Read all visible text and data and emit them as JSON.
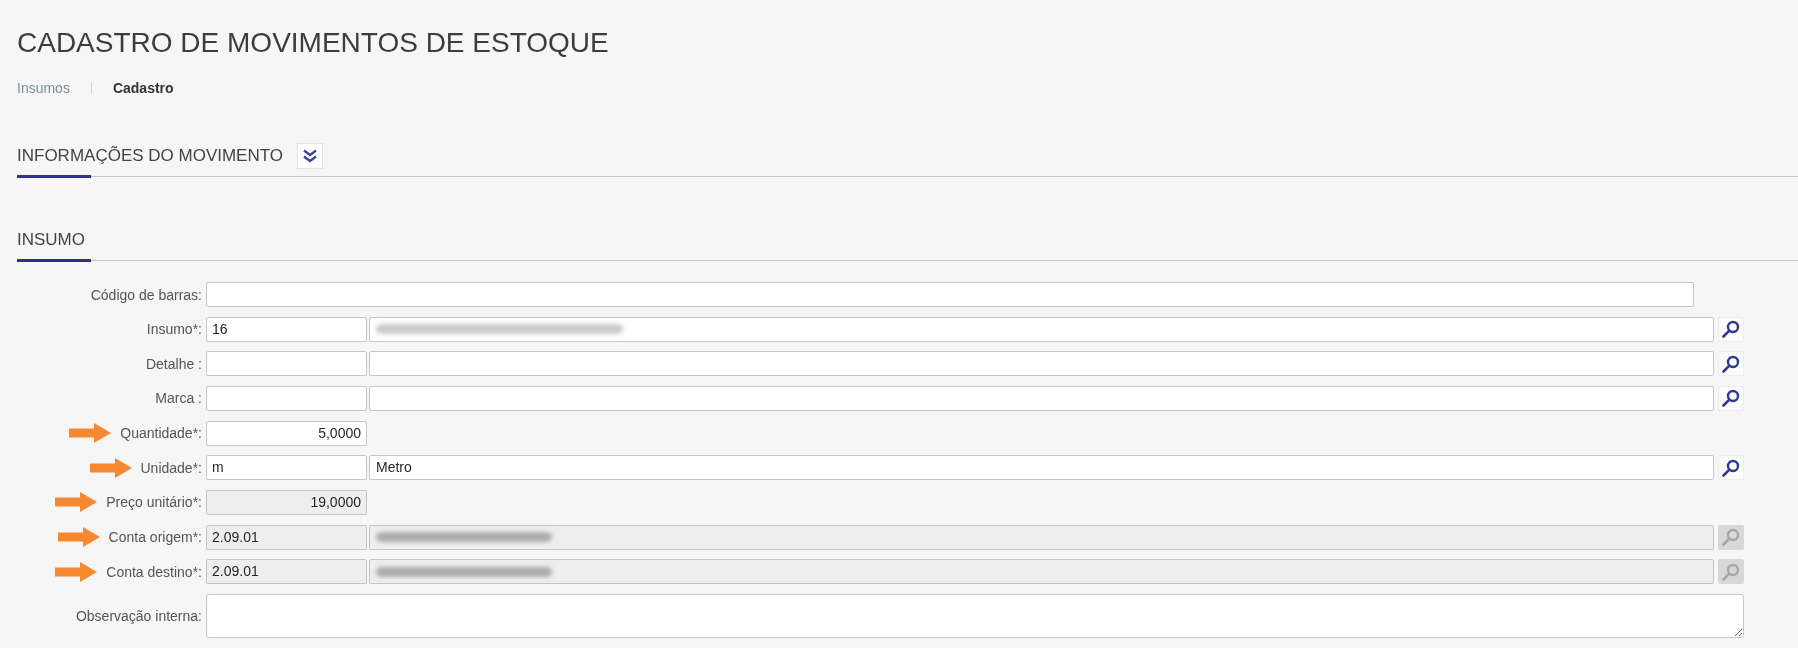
{
  "page": {
    "title": "CADASTRO DE MOVIMENTOS DE ESTOQUE"
  },
  "breadcrumb": [
    {
      "label": "Insumos",
      "current": false
    },
    {
      "label": "Cadastro",
      "current": true
    }
  ],
  "sections": [
    {
      "title": "INFORMAÇÕES DO MOVIMENTO",
      "toggle": {
        "expanded": false
      }
    },
    {
      "title": "INSUMO",
      "fields": [
        {
          "kind": "text",
          "label": "Código de barras:",
          "annotated": false,
          "disabled": false
        },
        {
          "kind": "lookup",
          "label": "Insumo*:",
          "code": "16",
          "description_blurred": true,
          "annotated": false,
          "disabled": false
        },
        {
          "kind": "lookup",
          "label": "Detalhe :",
          "description_blurred": false,
          "annotated": false,
          "disabled": false
        },
        {
          "kind": "lookup",
          "label": "Marca :",
          "description_blurred": false,
          "annotated": false,
          "disabled": false
        },
        {
          "kind": "number",
          "label": "Quantidade*:",
          "value": "5,0000",
          "annotated": true,
          "disabled": false
        },
        {
          "kind": "lookup",
          "label": "Unidade*:",
          "code": "m",
          "description": "Metro",
          "description_blurred": false,
          "annotated": true,
          "disabled": false
        },
        {
          "kind": "number",
          "label": "Preço unitário*:",
          "value": "19,0000",
          "annotated": true,
          "disabled": true
        },
        {
          "kind": "lookup",
          "label": "Conta origem*:",
          "code": "2.09.01",
          "description_blurred": true,
          "annotated": true,
          "disabled": true
        },
        {
          "kind": "lookup",
          "label": "Conta destino*:",
          "code": "2.09.01",
          "description_blurred": true,
          "annotated": true,
          "disabled": true
        },
        {
          "kind": "textarea",
          "label": "Observação interna:",
          "annotated": false,
          "disabled": false
        }
      ]
    }
  ]
}
